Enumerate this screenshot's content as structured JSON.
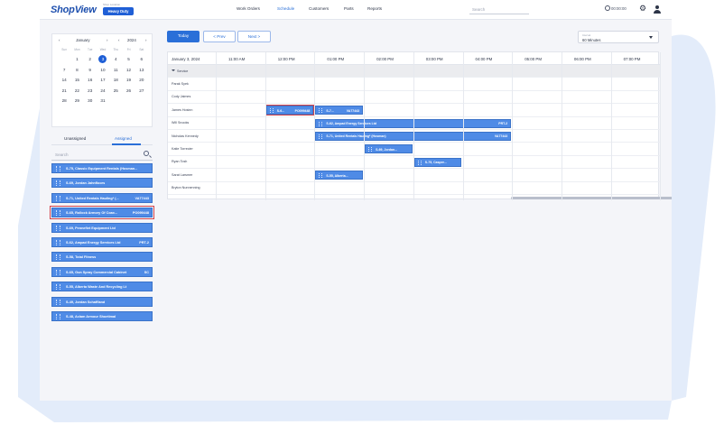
{
  "header": {
    "logo": "ShopView",
    "tenant_label": "Shop Location",
    "tenant_name": "Heavy Duty",
    "nav": [
      "Work Orders",
      "Schedule",
      "Customers",
      "Parts",
      "Reports"
    ],
    "active_nav": "Schedule",
    "search_placeholder": "Search",
    "clock": "00:00:00"
  },
  "calendar": {
    "month": "January",
    "year": "2024",
    "weekdays": [
      "Sun",
      "Mon",
      "Tue",
      "Wed",
      "Thu",
      "Fri",
      "Sat"
    ],
    "weeks": [
      [
        "",
        "1",
        "2",
        "3",
        "4",
        "5",
        "6"
      ],
      [
        "7",
        "8",
        "9",
        "10",
        "11",
        "12",
        "13"
      ],
      [
        "14",
        "15",
        "16",
        "17",
        "18",
        "19",
        "20"
      ],
      [
        "21",
        "22",
        "23",
        "24",
        "25",
        "26",
        "27"
      ],
      [
        "28",
        "29",
        "30",
        "31",
        "",
        "",
        ""
      ]
    ],
    "selected": "3"
  },
  "unassigned_panel": {
    "tabs": [
      "Unassigned",
      "Assigned"
    ],
    "active_tab": "Assigned",
    "search_placeholder": "Search",
    "items": [
      {
        "text": "S-75, Classic Equipment Rentals (Hosman...",
        "tag": ""
      },
      {
        "text": "S-69, Jordan Jahnfloors",
        "tag": ""
      },
      {
        "text": "S-71, United Rentals Hauling* (...",
        "tag": "VA77443"
      },
      {
        "text": "S-65, Rollock Armory Of Coax...",
        "tag": "PO099448"
      },
      {
        "text": "S-69, Pennefiet Equipment Ltd",
        "tag": ""
      },
      {
        "text": "S-62, Ampad Energy Services Ltd",
        "tag": "PRT-2"
      },
      {
        "text": "S-58, Total Fitness",
        "tag": ""
      },
      {
        "text": "S-65, Gun Spray Commercial Cabinet",
        "tag": "SC"
      },
      {
        "text": "S-55, Alberta Waste And Recycling Lt",
        "tag": ""
      },
      {
        "text": "S-49, Jordan Schaffland",
        "tag": ""
      },
      {
        "text": "S-48, Aclam Armour Shoetimal",
        "tag": ""
      }
    ]
  },
  "toolbar": {
    "today": "Today",
    "prev": "< Prev",
    "next": "Next >"
  },
  "interval": {
    "label": "Interval",
    "value": "60 Minutes"
  },
  "schedule": {
    "date": "January 3, 2024",
    "hours": [
      "11:00 AM",
      "12:00 PM",
      "01:00 PM",
      "02:00 PM",
      "03:00 PM",
      "04:00 PM",
      "05:00 PM",
      "06:00 PM",
      "07:00 PM"
    ],
    "rows": [
      {
        "name": "Service",
        "group": true
      },
      {
        "name": "Parak Syek"
      },
      {
        "name": "Cody Jaimes"
      },
      {
        "name": "James Hosinn"
      },
      {
        "name": "Will Snooks"
      },
      {
        "name": "Nicholas Kennedy"
      },
      {
        "name": "Katie Torrecier"
      },
      {
        "name": "Ryan Tosh"
      },
      {
        "name": "Sarat Larsmer"
      },
      {
        "name": "Bryton Nunnenning"
      }
    ],
    "events": [
      {
        "row": 3,
        "start": 1.0,
        "end": 2.0,
        "text": "S-6...",
        "tag": "PO099448",
        "highlight": true
      },
      {
        "row": 3,
        "start": 2.0,
        "end": 3.0,
        "text": "S-7...",
        "tag": "VA77443",
        "highlight": false
      },
      {
        "row": 4,
        "start": 2.0,
        "end": 6.0,
        "text": "S-62, Ampad Energy Services Ltd",
        "tag": "PRT-2",
        "highlight": false
      },
      {
        "row": 5,
        "start": 2.0,
        "end": 6.0,
        "text": "S-71, United Rentals Hauling* (Hosman)",
        "tag": "VA77443",
        "highlight": false
      },
      {
        "row": 6,
        "start": 3.0,
        "end": 4.0,
        "text": "S-69, Jordan...",
        "tag": "",
        "highlight": false
      },
      {
        "row": 7,
        "start": 4.0,
        "end": 5.0,
        "text": "S-75, Casper...",
        "tag": "",
        "highlight": false
      },
      {
        "row": 8,
        "start": 2.0,
        "end": 3.0,
        "text": "S-55, Alberta...",
        "tag": "",
        "highlight": false
      }
    ]
  },
  "colors": {
    "accent": "#2a6fd8",
    "event": "#4f8be6",
    "highlight": "#d1434b",
    "backdrop": "#dfe9f8"
  }
}
